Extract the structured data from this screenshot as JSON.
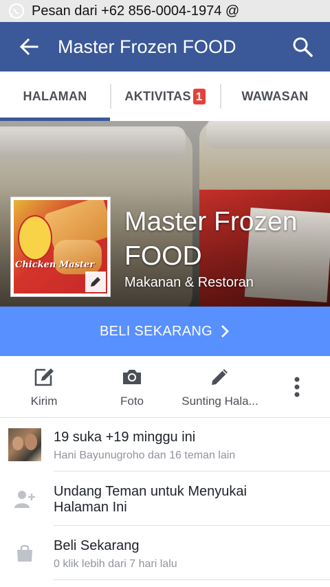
{
  "status_bar": {
    "notification": "Pesan dari +62 856-0004-1974 @"
  },
  "app_bar": {
    "title": "Master Frozen FOOD"
  },
  "tabs": [
    {
      "label": "HALAMAN",
      "active": true
    },
    {
      "label": "AKTIVITAS",
      "badge": "1",
      "active": false
    },
    {
      "label": "WAWASAN",
      "active": false
    }
  ],
  "page": {
    "name": "Master Frozen FOOD",
    "category": "Makanan & Restoran",
    "profile_text": "Chicken Master"
  },
  "cta": {
    "label": "BELI SEKARANG"
  },
  "actions": [
    {
      "label": "Kirim",
      "icon": "compose-icon"
    },
    {
      "label": "Foto",
      "icon": "camera-icon"
    },
    {
      "label": "Sunting Hala...",
      "icon": "pencil-icon"
    },
    {
      "label": "",
      "icon": "more-vertical-icon"
    }
  ],
  "list": [
    {
      "title": "19 suka +19 minggu ini",
      "subtitle": "Hani Bayunugroho dan 16 teman lain",
      "icon": "avatar"
    },
    {
      "title": "Undang Teman untuk Menyukai Halaman Ini",
      "subtitle": "",
      "icon": "add-friend-icon"
    },
    {
      "title": "Beli Sekarang",
      "subtitle": "0 klik lebih dari 7 hari lalu",
      "icon": "shopping-bag-icon"
    }
  ],
  "colors": {
    "app_bar": "#3b5998",
    "cta": "#5890ff",
    "badge": "#e4413a"
  }
}
